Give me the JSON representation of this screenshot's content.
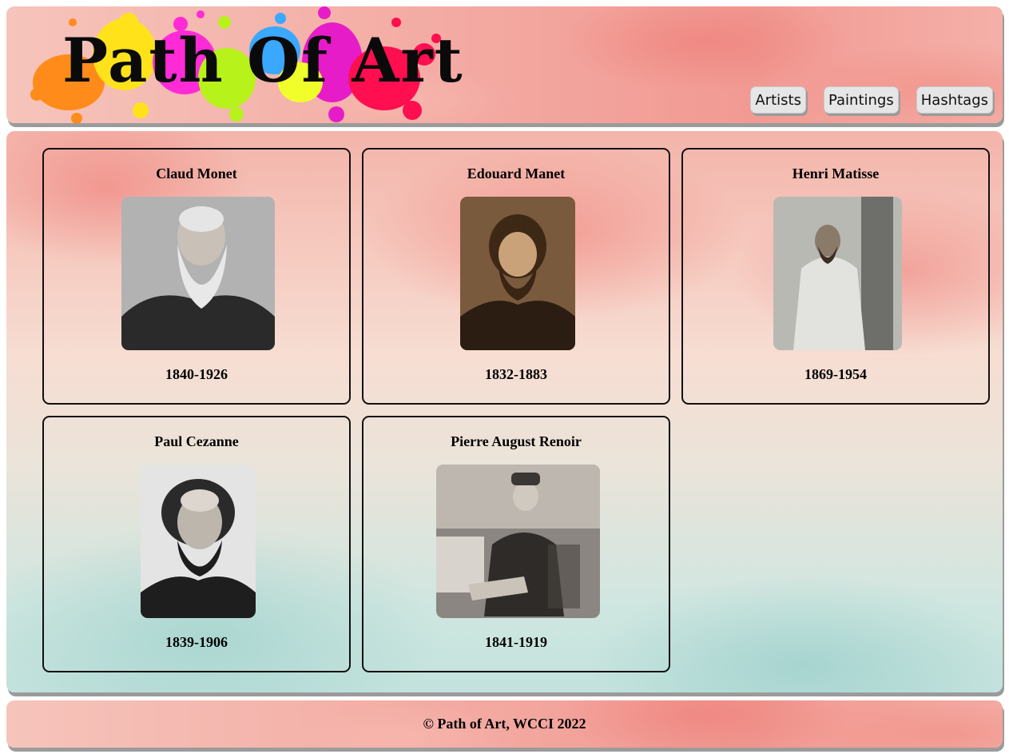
{
  "header": {
    "logo_text": "Path Of Art",
    "nav": [
      {
        "label": "Artists"
      },
      {
        "label": "Paintings"
      },
      {
        "label": "Hashtags"
      }
    ]
  },
  "artists": [
    {
      "name": "Claud Monet",
      "years": "1840-1926"
    },
    {
      "name": "Edouard Manet",
      "years": "1832-1883"
    },
    {
      "name": "Henri Matisse",
      "years": "1869-1954"
    },
    {
      "name": "Paul Cezanne",
      "years": "1839-1906"
    },
    {
      "name": "Pierre August Renoir",
      "years": "1841-1919"
    }
  ],
  "footer": {
    "text": "© Path of Art, WCCI 2022"
  },
  "colors": {
    "accent_pink": "#f19a93",
    "accent_teal": "#c3e2dd",
    "card_border": "#111111"
  }
}
